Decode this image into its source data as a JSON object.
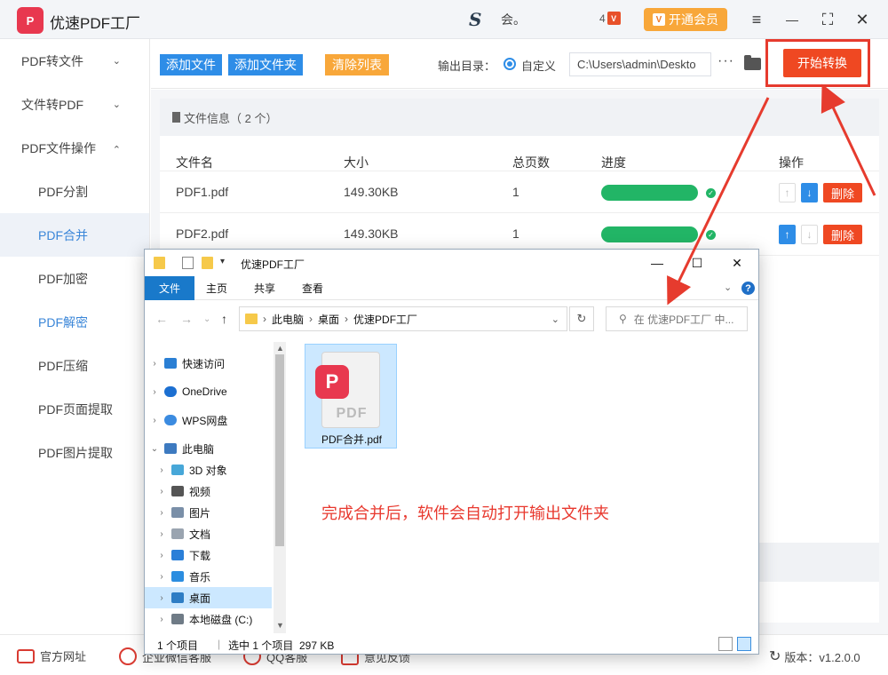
{
  "app": {
    "logo_text": "P",
    "title": "优速PDF工厂",
    "user_name": "会。",
    "vip_level": "4",
    "vip_button": "开通会员",
    "vip_icon": "V"
  },
  "window_controls": {
    "menu": "≡",
    "minimize": "—",
    "maximize": "⛶",
    "close": "✕"
  },
  "sidebar": {
    "items": [
      {
        "label": "PDF转文件",
        "chev": "⌄"
      },
      {
        "label": "文件转PDF",
        "chev": "⌄"
      },
      {
        "label": "PDF文件操作",
        "chev": "⌃"
      },
      {
        "label": "PDF分割"
      },
      {
        "label": "PDF合并"
      },
      {
        "label": "PDF加密"
      },
      {
        "label": "PDF解密"
      },
      {
        "label": "PDF压缩"
      },
      {
        "label": "PDF页面提取"
      },
      {
        "label": "PDF图片提取"
      }
    ]
  },
  "toolbar": {
    "add_file": "添加文件",
    "add_folder": "添加文件夹",
    "clear_list": "清除列表",
    "output_label": "输出目录：",
    "radio_label": "自定义",
    "path_value": "C:\\Users\\admin\\Deskto",
    "more": "···",
    "start": "开始转换"
  },
  "file_list": {
    "header": "文件信息（ 2 个）",
    "columns": [
      "文件名",
      "大小",
      "总页数",
      "进度",
      "操作"
    ],
    "rows": [
      {
        "name": "PDF1.pdf",
        "size": "149.30KB",
        "pages": "1",
        "progress": 1.0,
        "delete": "删除"
      },
      {
        "name": "PDF2.pdf",
        "size": "149.30KB",
        "pages": "1",
        "progress": 1.0,
        "delete": "删除"
      }
    ]
  },
  "bottom_bar": {
    "links": [
      "官方网址",
      "企业微信客服",
      "QQ客服",
      "意见反馈"
    ],
    "version": "版本：v1.2.0.0"
  },
  "explorer": {
    "title": "优速PDF工厂",
    "ribbon_tabs": [
      "文件",
      "主页",
      "共享",
      "查看"
    ],
    "breadcrumb": [
      "此电脑",
      "桌面",
      "优速PDF工厂"
    ],
    "search_placeholder": "在 优速PDF工厂 中...",
    "tree": [
      {
        "label": "快速访问",
        "icon_color": "#2a7fd4"
      },
      {
        "label": "OneDrive",
        "icon_color": "#1c6fd1"
      },
      {
        "label": "WPS网盘",
        "icon_color": "#3b8be0"
      },
      {
        "label": "此电脑",
        "icon_color": "#3d7ac0"
      },
      {
        "label": "3D 对象",
        "icon_color": "#47a7d8"
      },
      {
        "label": "视频",
        "icon_color": "#555555"
      },
      {
        "label": "图片",
        "icon_color": "#7a8fa8"
      },
      {
        "label": "文档",
        "icon_color": "#9aa4b0"
      },
      {
        "label": "下载",
        "icon_color": "#2b7fd8"
      },
      {
        "label": "音乐",
        "icon_color": "#2b8de0"
      },
      {
        "label": "桌面",
        "icon_color": "#2e7dc4"
      },
      {
        "label": "本地磁盘 (C:)",
        "icon_color": "#6f7b86"
      }
    ],
    "file": {
      "name": "PDF合并.pdf",
      "badge": "P",
      "doc_label": "PDF"
    },
    "annotation": "完成合并后，软件会自动打开输出文件夹",
    "status_count": "1 个项目",
    "status_selected": "选中 1 个项目  297 KB"
  }
}
